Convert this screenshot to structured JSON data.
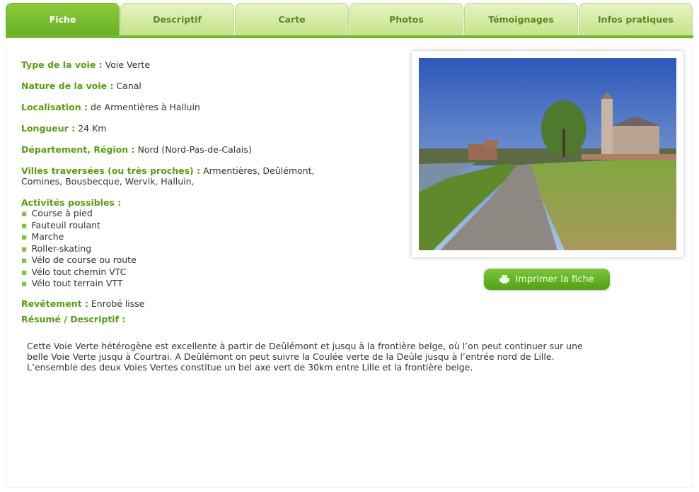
{
  "tabs": [
    {
      "label": "Fiche",
      "active": true
    },
    {
      "label": "Descriptif",
      "active": false
    },
    {
      "label": "Carte",
      "active": false
    },
    {
      "label": "Photos",
      "active": false
    },
    {
      "label": "Témoignages",
      "active": false
    },
    {
      "label": "Infos pratiques",
      "active": false
    }
  ],
  "fiche": {
    "type": {
      "label": "Type de la voie :",
      "value": "Voie Verte"
    },
    "nature": {
      "label": "Nature de la voie :",
      "value": "Canal"
    },
    "localisation": {
      "label": "Localisation :",
      "value": "de Armentières à Halluin"
    },
    "longueur": {
      "label": "Longueur :",
      "value": "24 Km"
    },
    "departement": {
      "label": "Département, Région :",
      "value": "Nord (Nord-Pas-de-Calais)"
    },
    "villes": {
      "label": "Villes traversées (ou très proches) :",
      "value_line1": "Armentières, Deûlémont,",
      "value_line2": "Comines, Bousbecque, Wervik, Halluin,"
    },
    "activites": {
      "label": "Activités possibles :",
      "items": [
        "Course à pied",
        "Fauteuil roulant",
        "Marche",
        "Roller-skating",
        "Vélo de course ou route",
        "Vélo tout chemin VTC",
        "Vélo tout terrain VTT"
      ]
    },
    "revetement": {
      "label": "Revêtement :",
      "value": "Enrobé lisse"
    },
    "resume": {
      "label": "Résumé / Descriptif :",
      "line1": "Cette Voie Verte hétérogène est excellente à partir de Deûlémont et jusqu à la frontière belge, où l’on peut continuer sur une",
      "line2": "belle Voie Verte jusqu à Courtrai. A Deûlémont on peut suivre la Coulée verte de la Deûle jusqu à l’entrée nord de Lille.",
      "line3": "L’ensemble des deux Voies Vertes constitue un bel axe vert de 30km entre Lille et la frontière belge."
    }
  },
  "print_button": {
    "label": "Imprimer la fiche",
    "icon": "printer-icon"
  },
  "colors": {
    "accent": "#6ab126",
    "label_green": "#5b9c12",
    "tab_inactive": "#d2ea9e"
  }
}
